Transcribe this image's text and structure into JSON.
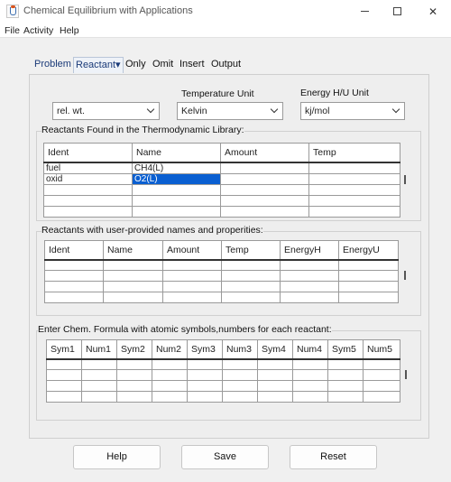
{
  "window": {
    "title": "Chemical Equilibrium with Applications"
  },
  "menu": [
    "File",
    "Activity",
    "Help"
  ],
  "tabs": [
    {
      "label": "Problem",
      "selected": false
    },
    {
      "label": "Reactant▾",
      "selected": true
    },
    {
      "label": "Only",
      "selected": false
    },
    {
      "label": "Omit",
      "selected": false
    },
    {
      "label": "Insert",
      "selected": false
    },
    {
      "label": "Output",
      "selected": false
    }
  ],
  "composition": {
    "value": "rel. wt."
  },
  "temperature_unit": {
    "label": "Temperature Unit",
    "value": "Kelvin"
  },
  "energy_unit": {
    "label": "Energy H/U Unit",
    "value": "kj/mol"
  },
  "library_reactants": {
    "title": "Reactants Found in the Thermodynamic Library:",
    "columns": [
      "Ident",
      "Name",
      "Amount",
      "Temp"
    ],
    "rows": [
      [
        "fuel",
        "CH4(L)",
        "",
        ""
      ],
      [
        "oxid",
        "O2(L)",
        "",
        ""
      ],
      [
        "",
        "",
        "",
        ""
      ],
      [
        "",
        "",
        "",
        ""
      ],
      [
        "",
        "",
        "",
        ""
      ]
    ]
  },
  "user_reactants": {
    "title": "Reactants with user-provided names and properities:",
    "columns": [
      "Ident",
      "Name",
      "Amount",
      "Temp",
      "EnergyH",
      "EnergyU"
    ],
    "rows": [
      [
        "",
        "",
        "",
        "",
        "",
        ""
      ],
      [
        "",
        "",
        "",
        "",
        "",
        ""
      ],
      [
        "",
        "",
        "",
        "",
        "",
        ""
      ],
      [
        "",
        "",
        "",
        "",
        "",
        ""
      ]
    ]
  },
  "formula": {
    "title": "Enter Chem. Formula with atomic symbols,numbers for each reactant:",
    "columns": [
      "Sym1",
      "Num1",
      "Sym2",
      "Num2",
      "Sym3",
      "Num3",
      "Sym4",
      "Num4",
      "Sym5",
      "Num5"
    ],
    "rows": [
      [
        "",
        "",
        "",
        "",
        "",
        "",
        "",
        "",
        "",
        ""
      ],
      [
        "",
        "",
        "",
        "",
        "",
        "",
        "",
        "",
        "",
        ""
      ],
      [
        "",
        "",
        "",
        "",
        "",
        "",
        "",
        "",
        "",
        ""
      ],
      [
        "",
        "",
        "",
        "",
        "",
        "",
        "",
        "",
        "",
        ""
      ]
    ]
  },
  "buttons": {
    "help": "Help",
    "save": "Save",
    "reset": "Reset"
  }
}
